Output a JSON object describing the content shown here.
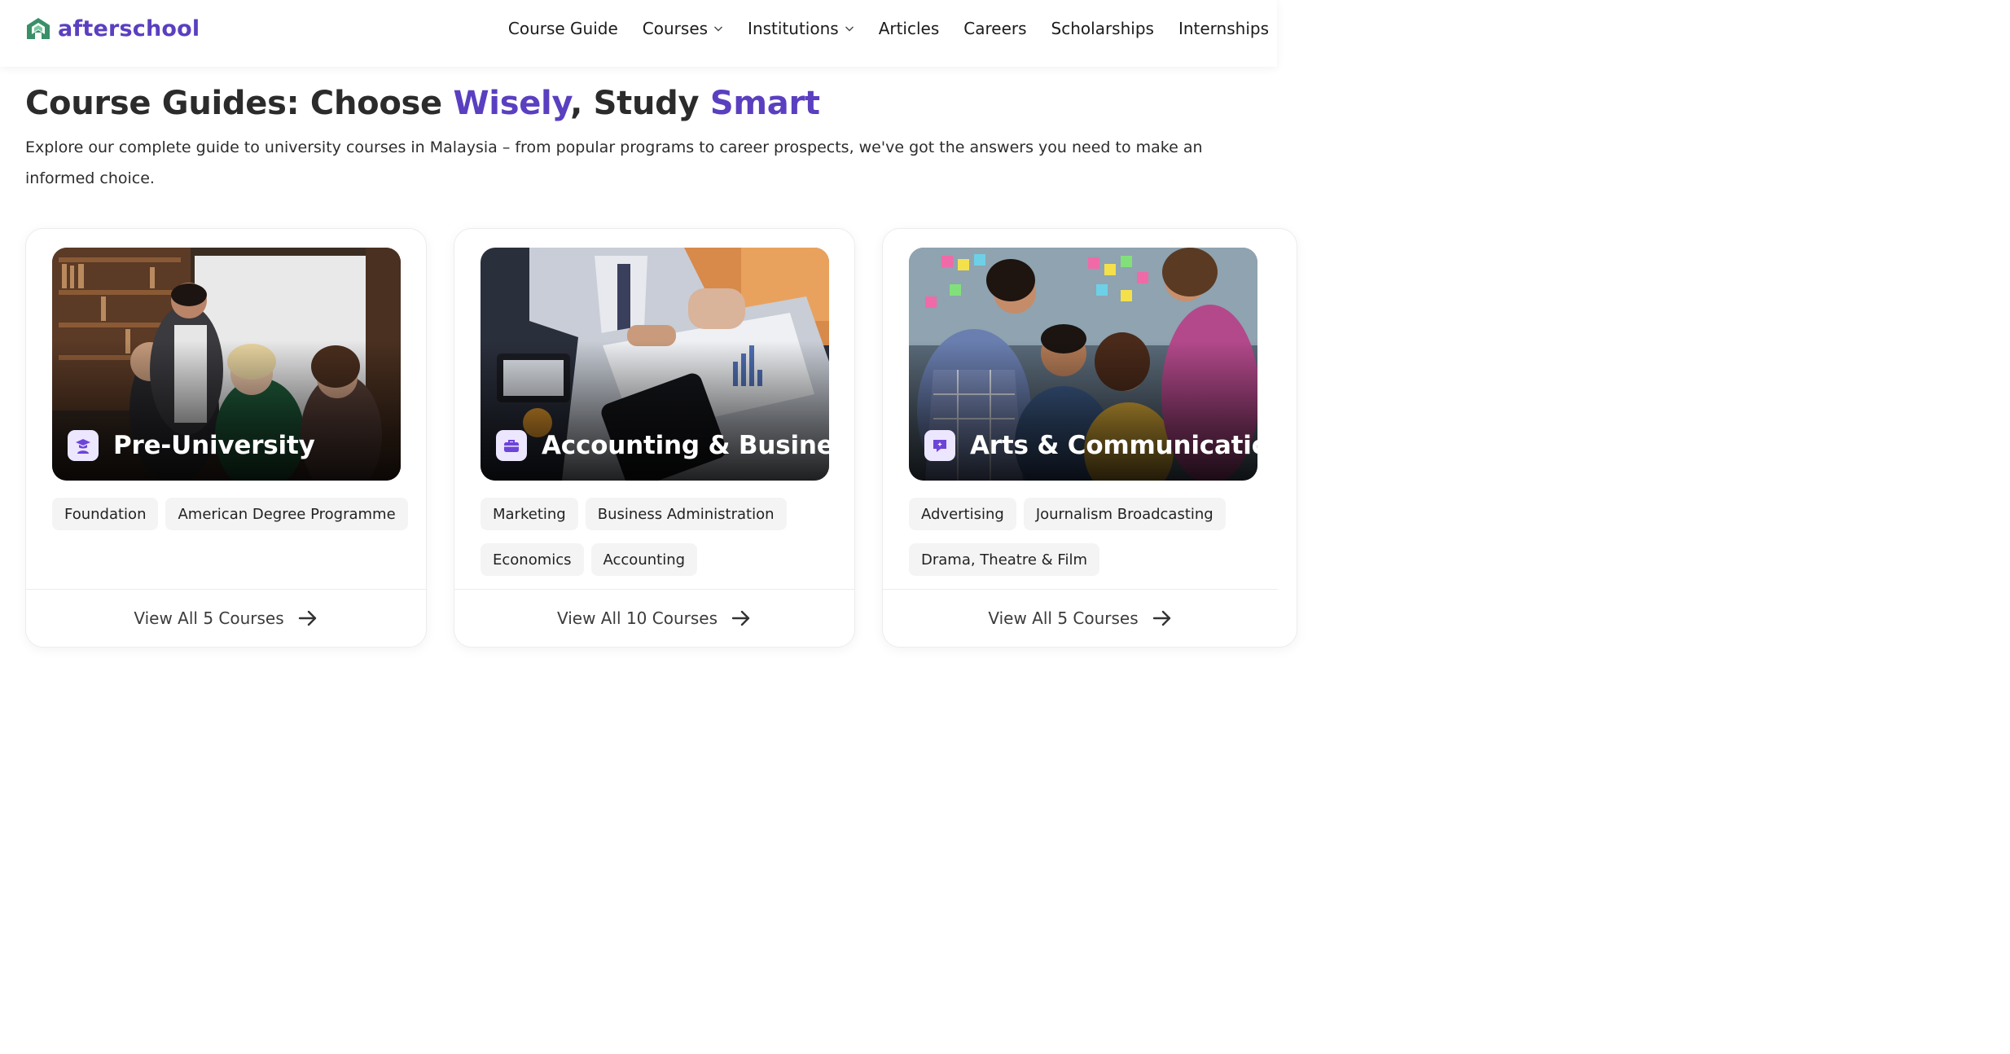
{
  "header": {
    "logo_text": "afterschool",
    "nav": [
      {
        "label": "Course Guide",
        "has_dropdown": false
      },
      {
        "label": "Courses",
        "has_dropdown": true
      },
      {
        "label": "Institutions",
        "has_dropdown": true
      },
      {
        "label": "Articles",
        "has_dropdown": false
      },
      {
        "label": "Careers",
        "has_dropdown": false
      },
      {
        "label": "Scholarships",
        "has_dropdown": false
      },
      {
        "label": "Internships",
        "has_dropdown": false
      }
    ]
  },
  "hero": {
    "title_part1": "Course Guides: Choose ",
    "title_accent1": "Wisely",
    "title_part2": ", Study ",
    "title_accent2": "Smart",
    "subtitle": "Explore our complete guide to university courses in Malaysia – from popular programs to career prospects, we've got the answers you need to make an informed choice."
  },
  "cards": [
    {
      "title": "Pre-University",
      "icon": "graduate-icon",
      "tags": [
        "Foundation",
        "American Degree Programme"
      ],
      "cta": "View All 5 Courses"
    },
    {
      "title": "Accounting & Business",
      "icon": "briefcase-icon",
      "tags": [
        "Marketing",
        "Business Administration",
        "Economics",
        "Accounting"
      ],
      "cta": "View All 10 Courses"
    },
    {
      "title": "Arts & Communication",
      "icon": "chat-bubble-icon",
      "tags": [
        "Advertising",
        "Journalism Broadcasting",
        "Drama, Theatre & Film"
      ],
      "cta": "View All 5 Courses"
    }
  ],
  "colors": {
    "brand": "#5a3fc0",
    "logo_green": "#3a8f68",
    "icon_bg": "#ece6ff",
    "tag_bg": "#f4f4f4"
  }
}
